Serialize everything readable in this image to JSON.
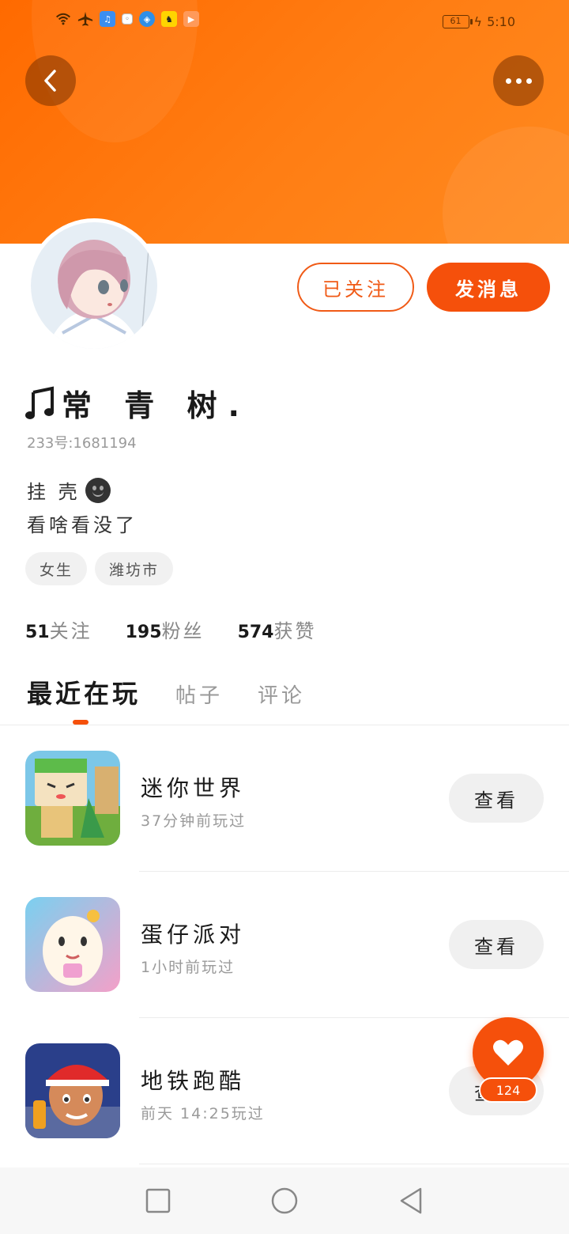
{
  "status_bar": {
    "battery": "61",
    "time": "5:10",
    "icons": [
      "wifi-icon",
      "airplane-mode-icon",
      "music-app-icon",
      "notification-icon",
      "browser-app-icon",
      "game-app-icon",
      "video-app-icon"
    ]
  },
  "header": {
    "back_icon": "back-arrow-icon",
    "more_icon": "more-options-icon",
    "gradient_color": "#ff6a00"
  },
  "profile": {
    "name": "常 青 树.",
    "name_icon": "music-note-icon",
    "uid": "233号:1681194",
    "follow_label": "已关注",
    "message_label": "发消息",
    "bio_line1": "挂 壳",
    "bio_emoji": "smiley-face-icon",
    "bio_line2": "看啥看没了",
    "tags": [
      "女生",
      "潍坊市"
    ],
    "stats": {
      "following_num": "51",
      "following_label": "关注",
      "fans_num": "195",
      "fans_label": "粉丝",
      "likes_num": "574",
      "likes_label": "获赞"
    }
  },
  "tabs": [
    "最近在玩",
    "帖子",
    "评论"
  ],
  "games": [
    {
      "name": "迷你世界",
      "time": "37分钟前玩过",
      "button": "查看"
    },
    {
      "name": "蛋仔派对",
      "time": "1小时前玩过",
      "button": "查看"
    },
    {
      "name": "地铁跑酷",
      "time": "前天 14:25玩过",
      "button": "查看"
    }
  ],
  "like_fab": {
    "count": "124",
    "icon": "heart-icon"
  },
  "navbar": {
    "icons": [
      "recent-apps-icon",
      "home-icon",
      "back-triangle-icon"
    ]
  },
  "accent_color": "#f5500b"
}
